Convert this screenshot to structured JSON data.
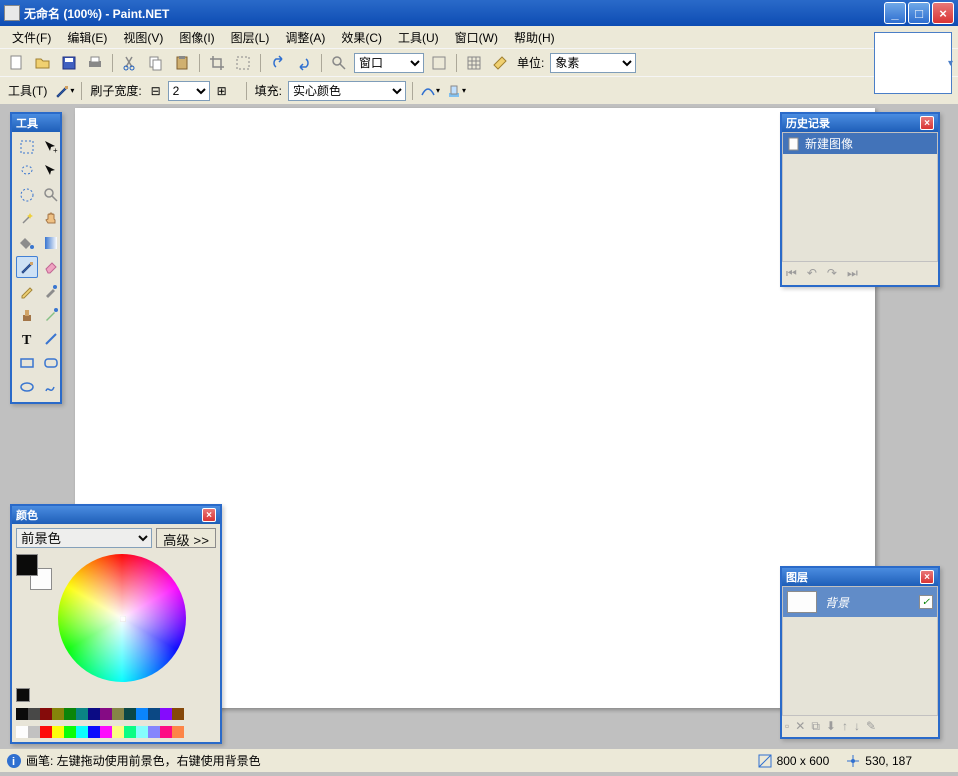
{
  "titlebar": {
    "title": "无命名 (100%) - Paint.NET"
  },
  "menubar": {
    "items": [
      {
        "label": "文件(F)"
      },
      {
        "label": "编辑(E)"
      },
      {
        "label": "视图(V)"
      },
      {
        "label": "图像(I)"
      },
      {
        "label": "图层(L)"
      },
      {
        "label": "调整(A)"
      },
      {
        "label": "效果(C)"
      },
      {
        "label": "工具(U)"
      },
      {
        "label": "窗口(W)"
      },
      {
        "label": "帮助(H)"
      }
    ]
  },
  "toolbar1": {
    "zoom_value": "窗口",
    "units_label": "单位:",
    "units_value": "象素"
  },
  "toolbar2": {
    "tools_label": "工具(T)",
    "brush_label": "刷子宽度:",
    "brush_value": "2",
    "fill_label": "填充:",
    "fill_value": "实心颜色"
  },
  "panels": {
    "tools_title": "工具",
    "history_title": "历史记录",
    "history_item": "新建图像",
    "layers_title": "图层",
    "layer_name": "背景",
    "colors_title": "颜色",
    "colors_mode": "前景色",
    "colors_advanced": "高级 >>"
  },
  "statusbar": {
    "hint": "画笔: 左键拖动使用前景色，右键使用背景色",
    "canvas_size": "800 x 600",
    "cursor_pos": "530, 187"
  },
  "palette_colors": [
    "#000",
    "#404040",
    "#800000",
    "#808000",
    "#008000",
    "#008080",
    "#000080",
    "#800080",
    "#808040",
    "#004040",
    "#0080ff",
    "#004080",
    "#8000ff",
    "#804000",
    "#fff",
    "#c0c0c0",
    "#f00",
    "#ff0",
    "#0f0",
    "#0ff",
    "#00f",
    "#f0f",
    "#ffff80",
    "#00ff80",
    "#80ffff",
    "#8080ff",
    "#ff0080",
    "#ff8040"
  ]
}
